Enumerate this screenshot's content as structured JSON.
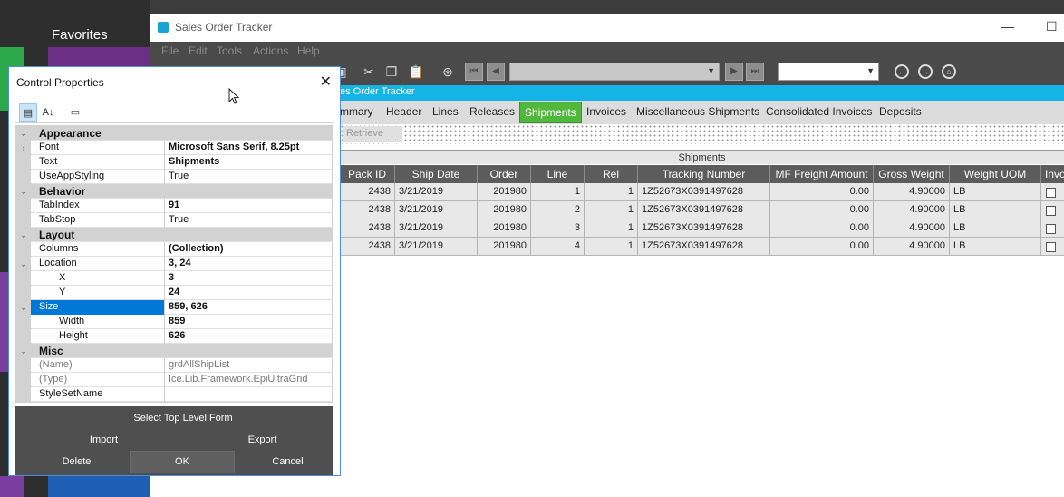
{
  "background": {
    "favorites_label": "Favorites",
    "tile_colors": [
      "#6b2f86",
      "#7a3da0",
      "#2aa84a",
      "#7a3da0",
      "#1e5fb3"
    ]
  },
  "window": {
    "title": "Sales Order Tracker",
    "minimize": "—",
    "maximize": "☐"
  },
  "menu": [
    "File",
    "Edit",
    "Tools",
    "Actions",
    "Help"
  ],
  "toolbar": {
    "icons": [
      "save-icon",
      "cut-icon",
      "copy-icon",
      "paste-icon",
      "binoculars-icon"
    ],
    "nav_first": "⏮",
    "nav_prev": "◀",
    "nav_next": "▶",
    "nav_last": "⏭",
    "combo_value": "",
    "search_value": ""
  },
  "form_header": "Sales Order Tracker",
  "tabs": [
    {
      "label": "Summary",
      "visible_label": "mmary",
      "active": false
    },
    {
      "label": "Header",
      "active": false
    },
    {
      "label": "Lines",
      "active": false
    },
    {
      "label": "Releases",
      "active": false
    },
    {
      "label": "Shipments",
      "active": true
    },
    {
      "label": "Invoices",
      "active": false
    },
    {
      "label": "Miscellaneous Shipments",
      "active": false
    },
    {
      "label": "Consolidated Invoices",
      "active": false
    },
    {
      "label": "Deposits",
      "active": false
    }
  ],
  "retrieve_label": "Retrieve",
  "grid": {
    "title": "Shipments",
    "columns": [
      "Pack ID",
      "Ship Date",
      "Order",
      "Line",
      "Rel",
      "Tracking Number",
      "MF Freight Amount",
      "Gross Weight",
      "Weight  UOM",
      "Invo"
    ],
    "rows": [
      [
        "2438",
        "3/21/2019",
        "201980",
        "1",
        "1",
        "1Z52673X0391497628",
        "0.00",
        "4.90000",
        "LB",
        ""
      ],
      [
        "2438",
        "3/21/2019",
        "201980",
        "2",
        "1",
        "1Z52673X0391497628",
        "0.00",
        "4.90000",
        "LB",
        ""
      ],
      [
        "2438",
        "3/21/2019",
        "201980",
        "3",
        "1",
        "1Z52673X0391497628",
        "0.00",
        "4.90000",
        "LB",
        ""
      ],
      [
        "2438",
        "3/21/2019",
        "201980",
        "4",
        "1",
        "1Z52673X0391497628",
        "0.00",
        "4.90000",
        "LB",
        ""
      ]
    ]
  },
  "dialog": {
    "title": "Control Properties",
    "close": "✕",
    "toolbar": {
      "categorized": "▤",
      "alphabetical": "A↓",
      "pages": "▭"
    },
    "properties": [
      {
        "kind": "cat",
        "name": "Appearance"
      },
      {
        "kind": "prop",
        "name": "Font",
        "value": "Microsoft Sans Serif, 8.25pt",
        "bold": true,
        "expander": "›"
      },
      {
        "kind": "prop",
        "name": "Text",
        "value": "Shipments",
        "bold": true
      },
      {
        "kind": "prop",
        "name": "UseAppStyling",
        "value": "True"
      },
      {
        "kind": "cat",
        "name": "Behavior"
      },
      {
        "kind": "prop",
        "name": "TabIndex",
        "value": "91",
        "bold": true
      },
      {
        "kind": "prop",
        "name": "TabStop",
        "value": "True"
      },
      {
        "kind": "cat",
        "name": "Layout"
      },
      {
        "kind": "prop",
        "name": "Columns",
        "value": "(Collection)",
        "bold": true
      },
      {
        "kind": "prop",
        "name": "Location",
        "value": "3, 24",
        "bold": true,
        "expander": "⌄"
      },
      {
        "kind": "sub",
        "name": "X",
        "value": "3",
        "bold": true
      },
      {
        "kind": "sub",
        "name": "Y",
        "value": "24",
        "bold": true
      },
      {
        "kind": "prop",
        "name": "Size",
        "value": "859, 626",
        "bold": true,
        "expander": "⌄",
        "selected": true
      },
      {
        "kind": "sub",
        "name": "Width",
        "value": "859",
        "bold": true
      },
      {
        "kind": "sub",
        "name": "Height",
        "value": "626",
        "bold": true
      },
      {
        "kind": "cat",
        "name": "Misc"
      },
      {
        "kind": "prop",
        "name": "(Name)",
        "value": "grdAllShipList",
        "gray": true
      },
      {
        "kind": "prop",
        "name": "(Type)",
        "value": "Ice.Lib.Framework.EpiUltraGrid",
        "gray": true
      },
      {
        "kind": "prop",
        "name": "StyleSetName",
        "value": ""
      }
    ],
    "buttons": {
      "select_top": "Select Top Level Form",
      "import": "Import",
      "export": "Export",
      "delete": "Delete",
      "ok": "OK",
      "cancel": "Cancel"
    }
  }
}
